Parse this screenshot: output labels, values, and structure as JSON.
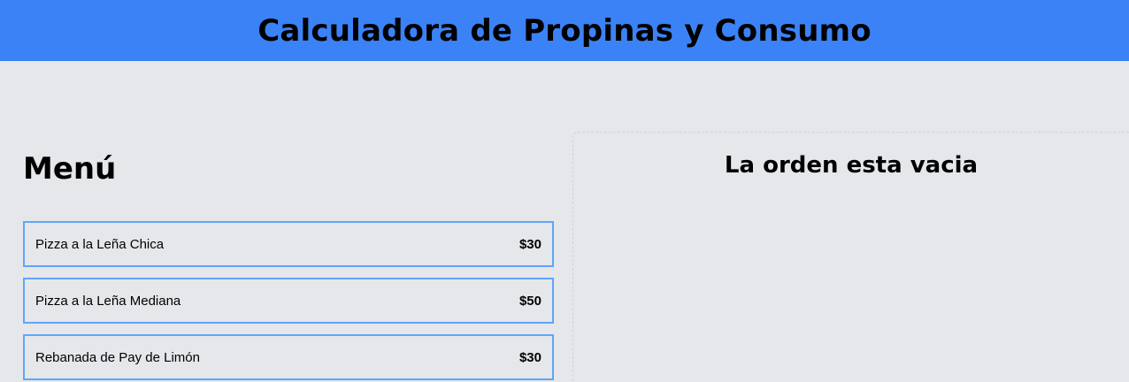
{
  "header": {
    "title": "Calculadora de Propinas y Consumo"
  },
  "menu": {
    "title": "Menú",
    "items": [
      {
        "name": "Pizza a la Leña Chica",
        "price": "$30"
      },
      {
        "name": "Pizza a la Leña Mediana",
        "price": "$50"
      },
      {
        "name": "Rebanada de Pay de Limón",
        "price": "$30"
      }
    ]
  },
  "order": {
    "empty_message": "La orden esta vacia"
  },
  "colors": {
    "header_bg": "#3b82f6",
    "page_bg": "#e5e7eb",
    "item_border": "#60a5fa"
  }
}
